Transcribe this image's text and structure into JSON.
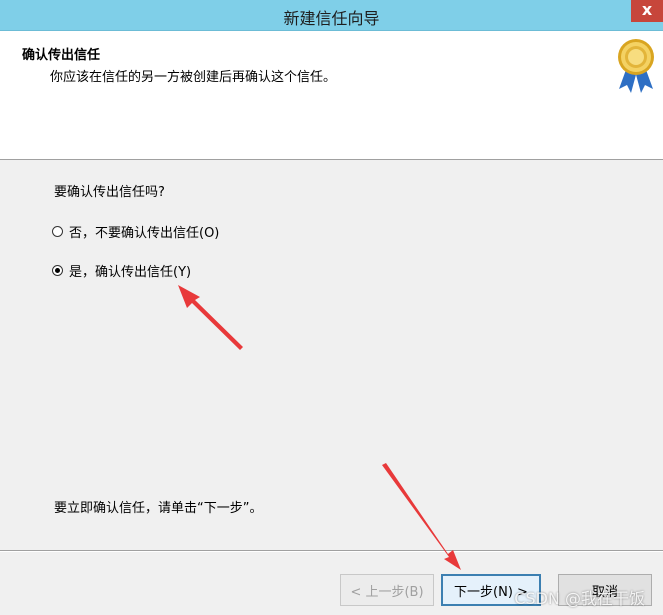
{
  "window": {
    "title": "新建信任向导",
    "close_label": "x"
  },
  "header": {
    "title": "确认传出信任",
    "description": "你应该在信任的另一方被创建后再确认这个信任。",
    "icon": "certificate-medal-icon"
  },
  "body": {
    "question": "要确认传出信任吗?",
    "options": [
      {
        "label": "否，不要确认传出信任(O)",
        "selected": false
      },
      {
        "label": "是，确认传出信任(Y)",
        "selected": true
      }
    ],
    "instruction": "要立即确认信任，请单击“下一步”。"
  },
  "buttons": {
    "back": "< 上一步(B)",
    "next": "下一步(N) >",
    "cancel": "取消"
  },
  "watermark": "CSDN @我在干饭",
  "colors": {
    "titlebar": "#7fcfe8",
    "close": "#c7463b",
    "annotation_arrow": "#e8393a"
  }
}
